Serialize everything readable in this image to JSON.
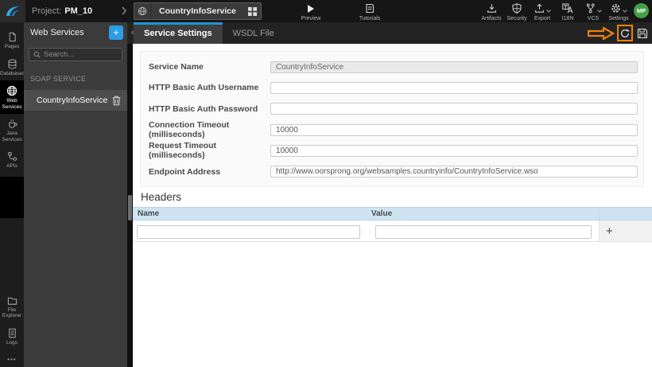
{
  "colors": {
    "accent_blue": "#2b9ce8",
    "active_tab_blue": "#2095d2",
    "annotation_orange": "#ef820d",
    "avatar_green": "#43a047",
    "table_header_blue": "#cfe4f3",
    "topbar_bg": "#161616",
    "panel_bg": "#3b3b3b",
    "selected_item_bg": "#4d4d4d"
  },
  "icons": {
    "logo": "wavemaker-wave",
    "breadcrumb": "chevron-right",
    "service_tab_left": "globe",
    "service_tab_right": "grid",
    "preview": "play-triangle",
    "tutorials": "book-page",
    "artifacts": "download-tray",
    "security": "shield",
    "export": "upload-tray",
    "i18n": "translate",
    "vcs": "branch-graph",
    "settings": "gear",
    "dropdown": "chevron-down",
    "pages": "page",
    "databases": "database-cylinder",
    "web_services": "globe",
    "java_services": "coffee-cup",
    "apis": "connector",
    "file_explorer": "folder",
    "logs": "document-lines",
    "more": "ellipsis",
    "add": "plus",
    "collapse": "chevron-double-left",
    "search": "magnifier",
    "delete": "trash",
    "reload": "circular-arrow",
    "save": "floppy-disk",
    "add_header": "plus"
  },
  "topbar": {
    "project_label": "Project:",
    "project_name": "PM_10",
    "service_tab_label": "CountryInfoService",
    "preview_label": "Preview",
    "tutorials_label": "Tutorials",
    "actions": [
      {
        "label": "Artifacts"
      },
      {
        "label": "Security"
      },
      {
        "label": "Export",
        "dropdown": true
      },
      {
        "label": "I18N"
      },
      {
        "label": "VCS",
        "dropdown": true
      },
      {
        "label": "Settings",
        "dropdown": true
      }
    ],
    "avatar_initials": "MP"
  },
  "sidebar": {
    "items": [
      {
        "label": "Pages"
      },
      {
        "label": "Databases"
      },
      {
        "label": "Web Services",
        "selected": true
      },
      {
        "label": "Java Services"
      },
      {
        "label": "APIs"
      }
    ],
    "bottom_items": [
      {
        "label": "File Explorer"
      },
      {
        "label": "Logs"
      }
    ],
    "more_label": "•••"
  },
  "panel": {
    "title": "Web Services",
    "add_button": "+",
    "collapse_button": "«",
    "search_placeholder": "Search...",
    "section_label": "SOAP SERVICE",
    "items": [
      {
        "label": "CountryInfoService"
      }
    ]
  },
  "tabs": [
    {
      "label": "Service Settings",
      "active": true
    },
    {
      "label": "WSDL File",
      "active": false
    }
  ],
  "form": {
    "fields": [
      {
        "label": "Service Name",
        "value": "CountryInfoService",
        "readonly": true
      },
      {
        "label": "HTTP Basic Auth Username",
        "value": ""
      },
      {
        "label": "HTTP Basic Auth Password",
        "value": ""
      },
      {
        "label": "Connection Timeout (milliseconds)",
        "value": "10000"
      },
      {
        "label": "Request Timeout (milliseconds)",
        "value": "10000"
      },
      {
        "label": "Endpoint Address",
        "value": "http://www.oorsprong.org/websamples.countryinfo/CountryInfoService.wso"
      }
    ]
  },
  "headers_section": {
    "title": "Headers",
    "columns": [
      "Name",
      "Value"
    ],
    "add_button": "+",
    "rows": [
      {
        "name": "",
        "value": ""
      }
    ]
  }
}
